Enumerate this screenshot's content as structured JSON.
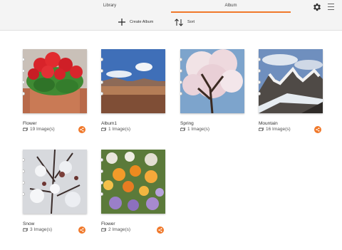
{
  "tabs": [
    {
      "label": "Library",
      "active": false
    },
    {
      "label": "Album",
      "active": true
    }
  ],
  "toolbar": {
    "create_label": "Create Album",
    "sort_label": "Sort"
  },
  "albums": [
    {
      "name": "Flower",
      "count": "19 Image(s)",
      "share": true
    },
    {
      "name": "Album1",
      "count": "1 Image(s)",
      "share": false
    },
    {
      "name": "Spring",
      "count": "1 Image(s)",
      "share": false
    },
    {
      "name": "Mountain",
      "count": "16 Image(s)",
      "share": true
    },
    {
      "name": "Snow",
      "count": "3 Image(s)",
      "share": true
    },
    {
      "name": "Flower",
      "count": "2 Image(s)",
      "share": true
    }
  ],
  "colors": {
    "accent": "#f0782a",
    "tab_bar_bg": "#f4f4f4"
  },
  "icons": {
    "settings": "gear-icon",
    "menu": "hamburger-menu-icon",
    "create": "plus-icon",
    "sort": "sort-arrows-icon",
    "count": "images-icon",
    "share": "share-icon"
  }
}
